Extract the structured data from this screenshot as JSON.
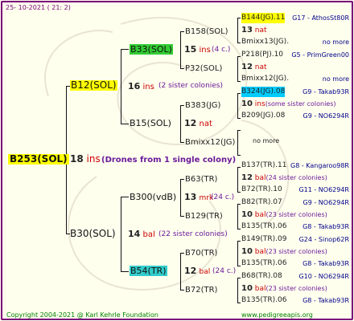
{
  "header_date": "25-  10-2021  (  21:   2)",
  "footer_left": "Copyright 2004-2021 @ Karl Kehrle Foundation",
  "footer_right": "www.pedigreeapis.org",
  "root": {
    "name": "B253(SOL)",
    "ins_num": "18",
    "ins": "ins",
    "note": "(Drones from 1 single colony)"
  },
  "g1": {
    "top": {
      "name": "B12(SOL)",
      "num": "16",
      "ins": "ins",
      "note": "(2 sister colonies)"
    },
    "bottom": {
      "name": "B30(SOL)",
      "num": "14",
      "ins": "bal",
      "note": "(22 sister colonies)"
    }
  },
  "g2": {
    "a": {
      "name": "B33(SOL)",
      "num": "15",
      "ins": "ins",
      "note": "(4 c.)"
    },
    "b": {
      "name": "B15(SOL)",
      "num": "12",
      "ins": "nat"
    },
    "c": {
      "name": "B300(vdB)",
      "num": "13",
      "ins": "mrk",
      "note": "(24 c.)"
    },
    "d": {
      "name": "B54(TR)",
      "num": "12",
      "ins": "bal",
      "note": "(24 c.)"
    }
  },
  "g3": {
    "a1": {
      "name": "B158(SOL)"
    },
    "a2": {
      "name": "P32(SOL)"
    },
    "b1": {
      "name": "B383(JG)"
    },
    "b2": {
      "name": "Bmixx12(JG)"
    },
    "c1": {
      "name": "B63(TR)"
    },
    "c2": {
      "name": "B129(TR)"
    },
    "d1": {
      "name": "B70(TR)"
    },
    "d2": {
      "name": "B72(TR)"
    }
  },
  "g4": [
    {
      "top": "B144(JG).11",
      "top_r": "G17 - AthosSt80R",
      "mid_num": "13",
      "mid_ins": "nat",
      "mid_note": "",
      "bot": "Bmixx13(JG).",
      "bot_r": "no more"
    },
    {
      "top": "P218(PJ).10",
      "top_r": "G5 - PrimGreen00",
      "mid_num": "12",
      "mid_ins": "nat",
      "mid_note": "",
      "bot": "Bmixx12(JG).",
      "bot_r": "no more"
    },
    {
      "top": "B324(JG).08",
      "top_r": "G9 - Takab93R",
      "mid_num": "10",
      "mid_ins": "ins",
      "mid_note": "(some sister colonies)",
      "bot": "B209(JG).08",
      "bot_r": "G9 - NO6294R"
    },
    {
      "top": "",
      "top_r": "",
      "mid_num": "",
      "mid_ins": "",
      "mid_note": "no more",
      "bot": "",
      "bot_r": ""
    },
    {
      "top": "B137(TR).11",
      "top_r": "G8 - Kangaroo98R",
      "mid_num": "12",
      "mid_ins": "bal",
      "mid_note": "(24 sister colonies)",
      "bot": "B72(TR).10",
      "bot_r": "G11 - NO6294R"
    },
    {
      "top": "B82(TR).07",
      "top_r": "G9 - NO6294R",
      "mid_num": "10",
      "mid_ins": "bal",
      "mid_note": "(23 sister colonies)",
      "bot": "B135(TR).06",
      "bot_r": "G8 - Takab93R"
    },
    {
      "top": "B149(TR).09",
      "top_r": "G24 - Sinop62R",
      "mid_num": "10",
      "mid_ins": "bal",
      "mid_note": "(23 sister colonies)",
      "bot": "B135(TR).06",
      "bot_r": "G8 - Takab93R"
    },
    {
      "top": "B68(TR).08",
      "top_r": "G10 - NO6294R",
      "mid_num": "10",
      "mid_ins": "bal",
      "mid_note": "(23 sister colonies)",
      "bot": "B135(TR).06",
      "bot_r": "G8 - Takab93R"
    }
  ]
}
